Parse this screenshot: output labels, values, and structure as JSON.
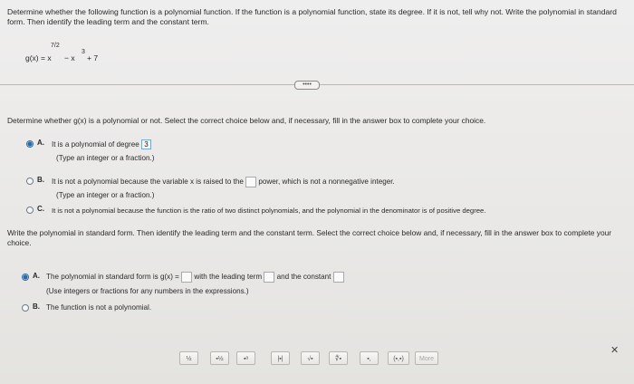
{
  "question": {
    "text": "Determine whether the following function is a polynomial function. If the function is a polynomial function, state its degree. If it is not, tell why not. Write the polynomial in standard form. Then identify the leading term and the constant term.",
    "function_lhs": "g(x) = x",
    "exponent_1": "7/2",
    "term2": "− x",
    "exponent_2": "3",
    "term3": "+ 7"
  },
  "expand_button": "••••",
  "part1": {
    "prompt": "Determine whether g(x) is a polynomial or not. Select the correct choice below and, if necessary, fill in the answer box to complete your choice.",
    "choices": [
      {
        "letter": "A.",
        "text_before": "It is a polynomial of degree",
        "answer": "3",
        "hint": "(Type an integer or a fraction.)",
        "selected": true
      },
      {
        "letter": "B.",
        "text_before": "It is not a polynomial because the variable x is raised to the",
        "text_after": "power, which is not a nonnegative integer.",
        "hint": "(Type an integer or a fraction.)",
        "selected": false
      },
      {
        "letter": "C.",
        "text": "It is not a polynomial because the function is the ratio of two distinct polynomials, and the polynomial in the denominator is of positive degree.",
        "selected": false
      }
    ]
  },
  "part2": {
    "prompt": "Write the polynomial in standard form. Then identify the leading term and the constant term. Select the correct choice below and, if necessary, fill in the answer box to complete your choice.",
    "choices": [
      {
        "letter": "A.",
        "text_1": "The polynomial in standard form is g(x) =",
        "text_2": "with the leading term",
        "text_3": "and the constant",
        "hint": "(Use integers or fractions for any numbers in the expressions.)",
        "selected": true
      },
      {
        "letter": "B.",
        "text": "The function is not a polynomial.",
        "selected": false
      }
    ]
  },
  "toolbar": {
    "buttons": [
      "½",
      "▪½",
      "▪ᵃ",
      "|▪|",
      "√▪",
      "∜▪",
      "▪,",
      "(▪,▪)"
    ],
    "more_label": "More"
  },
  "close_icon": "✕",
  "colors": {
    "accent": "#2b6aa6",
    "background": "#ecebea"
  }
}
